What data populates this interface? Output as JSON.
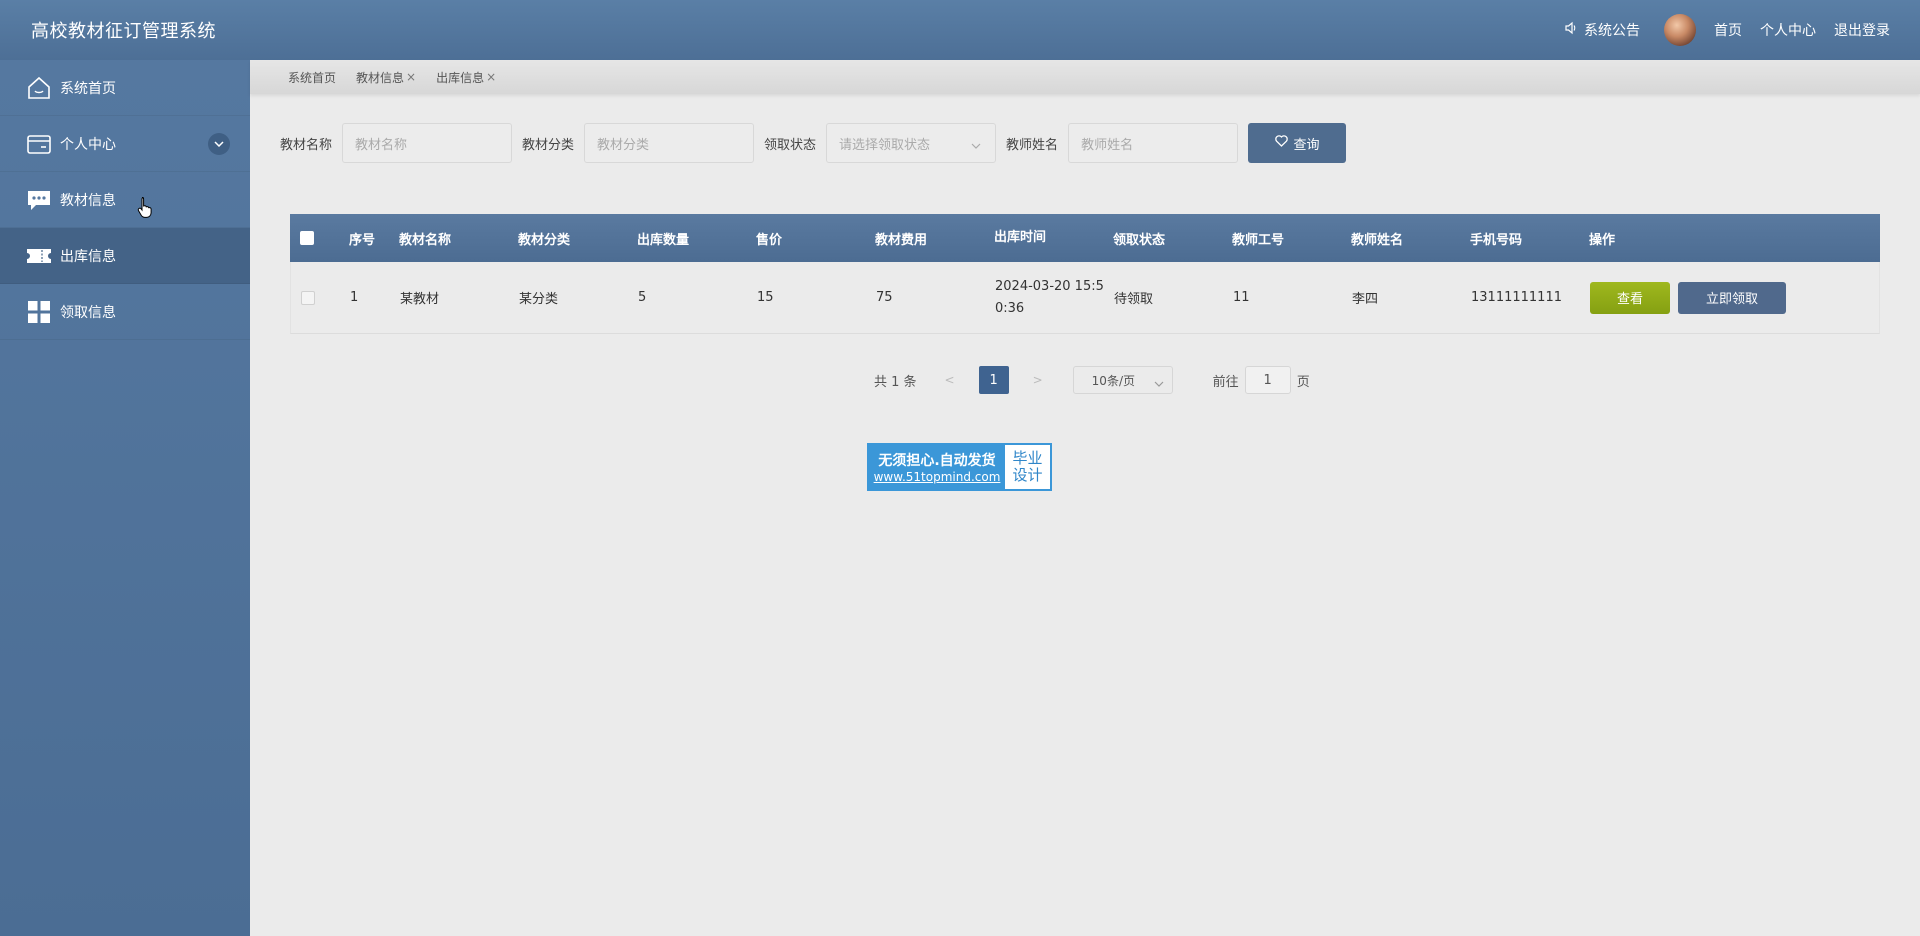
{
  "header": {
    "title": "高校教材征订管理系统",
    "notice": "系统公告",
    "links": [
      "首页",
      "个人中心",
      "退出登录"
    ]
  },
  "sidebar": {
    "items": [
      {
        "label": "系统首页",
        "icon": "home-icon"
      },
      {
        "label": "个人中心",
        "icon": "card-icon"
      },
      {
        "label": "教材信息",
        "icon": "chat-icon"
      },
      {
        "label": "出库信息",
        "icon": "ticket-icon"
      },
      {
        "label": "领取信息",
        "icon": "grid-icon"
      }
    ]
  },
  "tabs": [
    {
      "label": "系统首页",
      "closable": false
    },
    {
      "label": "教材信息",
      "closable": true
    },
    {
      "label": "出库信息",
      "closable": true
    }
  ],
  "search": {
    "fields": [
      {
        "label": "教材名称",
        "placeholder": "教材名称"
      },
      {
        "label": "教材分类",
        "placeholder": "教材分类"
      },
      {
        "label": "领取状态",
        "placeholder": "请选择领取状态"
      },
      {
        "label": "教师姓名",
        "placeholder": "教师姓名"
      }
    ],
    "button": "查询"
  },
  "table": {
    "headers": [
      "序号",
      "教材名称",
      "教材分类",
      "出库数量",
      "售价",
      "教材费用",
      "出库时间",
      "领取状态",
      "教师工号",
      "教师姓名",
      "手机号码",
      "操作"
    ],
    "rows": [
      {
        "index": "1",
        "name": "某教材",
        "category": "某分类",
        "qty": "5",
        "price": "15",
        "fee": "75",
        "time": "2024-03-20 15:50:36",
        "status": "待领取",
        "teacher_id": "11",
        "teacher_name": "李四",
        "phone": "13111111111",
        "actions": [
          "查看",
          "立即领取"
        ]
      }
    ]
  },
  "pager": {
    "total": "共 1 条",
    "prev": "<",
    "current": "1",
    "next": ">",
    "size": "10条/页",
    "goto_prefix": "前往",
    "goto_value": "1",
    "goto_suffix": "页"
  },
  "banner": {
    "line1": "无须担心.自动发货",
    "line2": "www.51topmind.com",
    "side1": "毕业",
    "side2": "设计"
  }
}
